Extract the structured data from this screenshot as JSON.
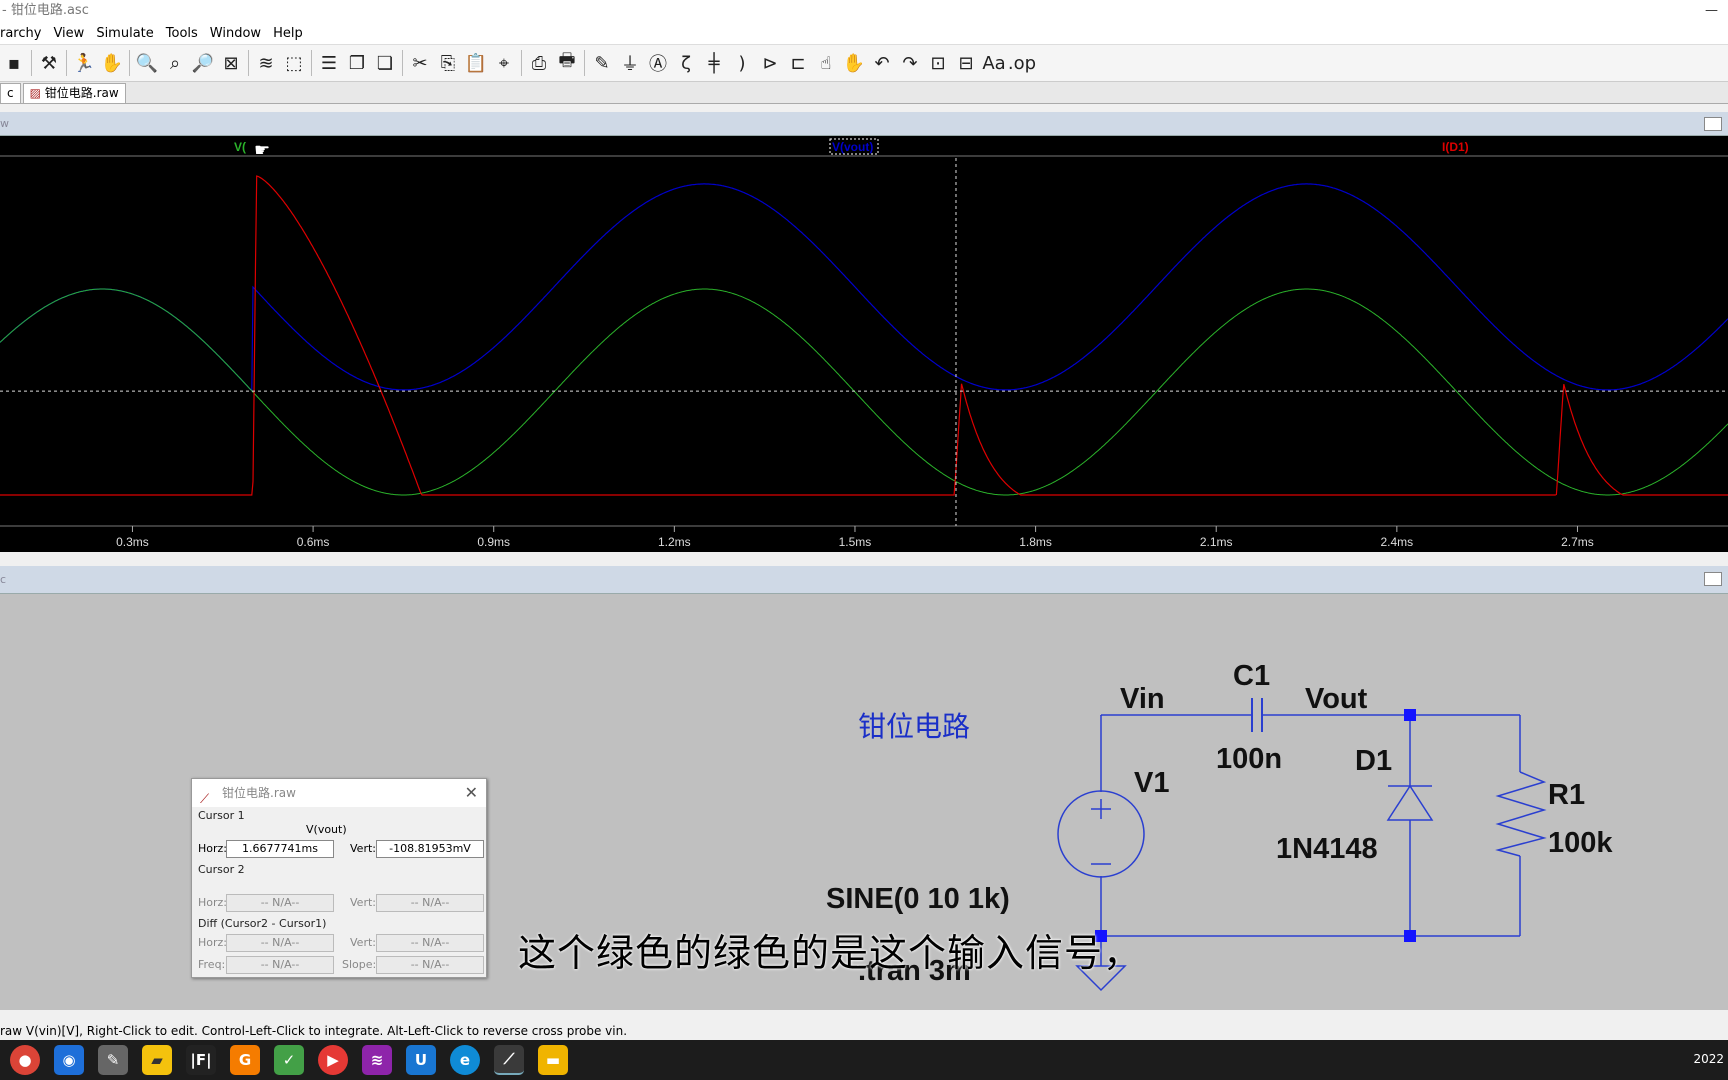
{
  "window": {
    "title": "- 钳位电路.asc",
    "controls": "—"
  },
  "menu": [
    "rarchy",
    "View",
    "Simulate",
    "Tools",
    "Window",
    "Help"
  ],
  "tabs": [
    {
      "label": "c"
    },
    {
      "label": "钳位电路.raw"
    }
  ],
  "wave_panel": {
    "title": "w"
  },
  "schematic_panel": {
    "title": "c"
  },
  "chart_data": {
    "type": "line",
    "x_unit": "ms",
    "x_ticks": [
      "0.3ms",
      "0.6ms",
      "0.9ms",
      "1.2ms",
      "1.5ms",
      "1.8ms",
      "2.1ms",
      "2.4ms",
      "2.7ms"
    ],
    "xlim": [
      0.08,
      2.95
    ],
    "series": [
      {
        "name": "V(vin)",
        "color": "#2bb32b",
        "label_shown": "V(",
        "kind": "sine",
        "amplitude": 10,
        "freq_khz": 1,
        "offset": 0
      },
      {
        "name": "V(vout)",
        "color": "#0000cc",
        "label_shown": "V(vout)",
        "kind": "clamped_sine"
      },
      {
        "name": "I(D1)",
        "color": "#dd0000",
        "label_shown": "I(D1)",
        "kind": "diode_pulses",
        "pulse_starts_ms": [
          0.5,
          1.665,
          2.665
        ]
      }
    ],
    "cursor": {
      "x": 1.6677741,
      "y": -0.10881953
    },
    "grid": false,
    "legend": "top"
  },
  "schematic": {
    "title": "钳位电路",
    "labels": {
      "vin": "Vin",
      "vout": "Vout",
      "c1": "C1",
      "c1_val": "100n",
      "d1": "D1",
      "d1_model": "1N4148",
      "v1": "V1",
      "v1_val": "SINE(0 10 1k)",
      "r1": "R1",
      "r1_val": "100k",
      "tran": ".tran 3m"
    },
    "wire_color": "#2a3fd0",
    "title_color": "#1a2fc8"
  },
  "cursor_window": {
    "title": "钳位电路.raw",
    "cursor1": {
      "group": "Cursor 1",
      "trace": "V(vout)",
      "horz_label": "Horz:",
      "horz": "1.6677741ms",
      "vert_label": "Vert:",
      "vert": "-108.81953mV"
    },
    "cursor2": {
      "group": "Cursor 2",
      "horz_label": "Horz:",
      "horz": "-- N/A--",
      "vert_label": "Vert:",
      "vert": "-- N/A--"
    },
    "diff": {
      "group": "Diff (Cursor2 - Cursor1)",
      "horz_label": "Horz:",
      "horz": "-- N/A--",
      "vert_label": "Vert:",
      "vert": "-- N/A--",
      "freq_label": "Freq:",
      "freq": "-- N/A--",
      "slope_label": "Slope:",
      "slope": "-- N/A--"
    }
  },
  "subtitle": "这个绿色的绿色的是这个输入信号，",
  "status": "raw V(vin)[V],  Right-Click to edit. Control-Left-Click to integrate. Alt-Left-Click to reverse cross probe vin.",
  "clock": "2022"
}
